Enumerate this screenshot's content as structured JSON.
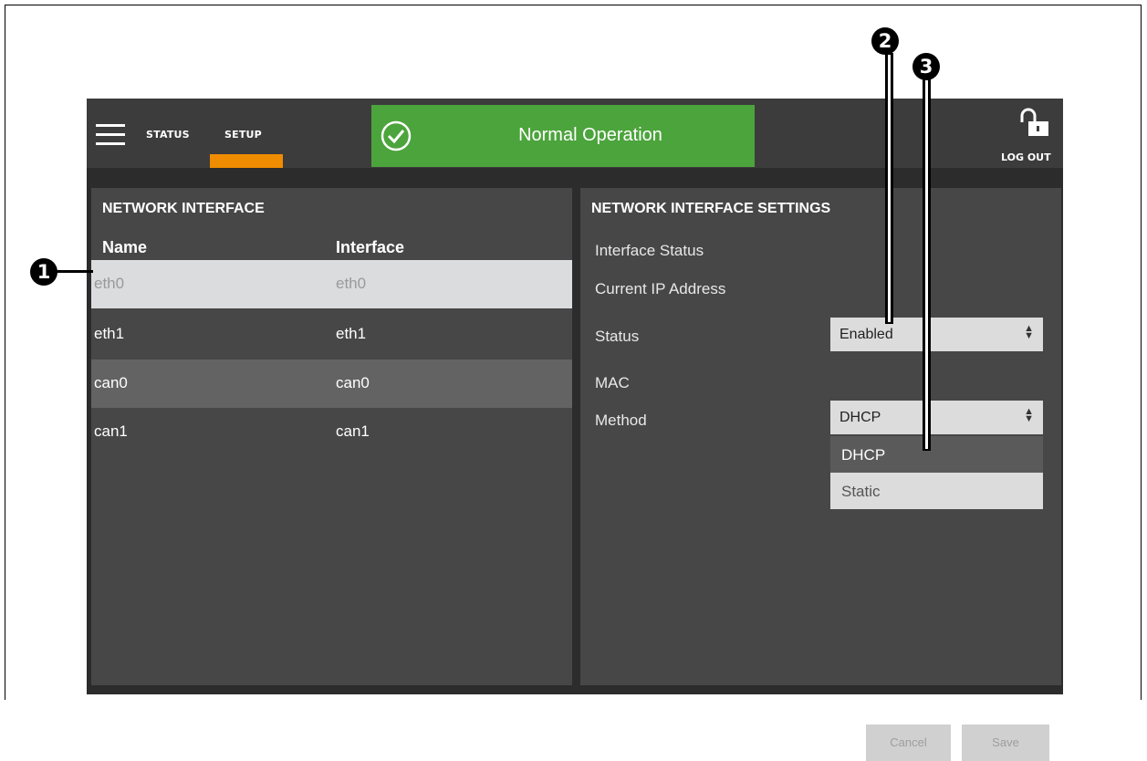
{
  "nav": {
    "tabs": [
      {
        "label": "STATUS"
      },
      {
        "label": "SETUP"
      }
    ],
    "active_tab": "SETUP",
    "logout_label": "LOG OUT"
  },
  "status_banner": {
    "text": "Normal Operation",
    "color": "#4ca43c"
  },
  "left_panel": {
    "title": "NETWORK INTERFACE",
    "columns": [
      "Name",
      "Interface"
    ],
    "rows": [
      {
        "name": "eth0",
        "interface": "eth0",
        "state": "selected"
      },
      {
        "name": "eth1",
        "interface": "eth1",
        "state": "normal"
      },
      {
        "name": "can0",
        "interface": "can0",
        "state": "highlighted"
      },
      {
        "name": "can1",
        "interface": "can1",
        "state": "normal"
      }
    ]
  },
  "right_panel": {
    "title": "NETWORK INTERFACE SETTINGS",
    "fields": {
      "interface_status": "Interface Status",
      "current_ip": "Current IP Address",
      "status": "Status",
      "mac": "MAC",
      "method": "Method"
    },
    "status_select": {
      "value": "Enabled"
    },
    "method_select": {
      "value": "DHCP",
      "options": [
        "DHCP",
        "Static"
      ]
    },
    "buttons": {
      "cancel": "Cancel",
      "save": "Save"
    }
  },
  "callouts": [
    "1",
    "2",
    "3"
  ],
  "colors": {
    "accent_orange": "#f08c00",
    "banner_green": "#4ca43c"
  },
  "icons": [
    "menu-icon",
    "check-circle-icon",
    "unlock-icon",
    "sort-arrows-icon"
  ]
}
